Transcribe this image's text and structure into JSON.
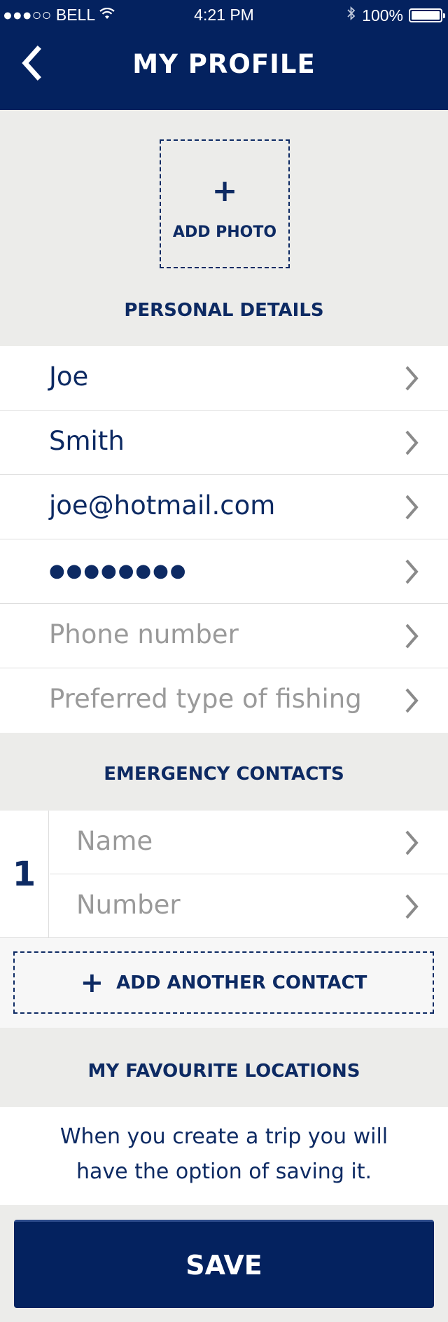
{
  "status_bar": {
    "carrier": "●●●○○ BELL",
    "time": "4:21 PM",
    "battery": "100%"
  },
  "header": {
    "title": "MY PROFILE"
  },
  "photo": {
    "plus": "+",
    "label": "ADD PHOTO"
  },
  "personal_details": {
    "title": "PERSONAL DETAILS",
    "fields": [
      {
        "value": "Joe"
      },
      {
        "value": "Smith"
      },
      {
        "value": "joe@hotmail.com"
      },
      {
        "value": "●●●●●●●●"
      },
      {
        "placeholder": "Phone number"
      },
      {
        "placeholder": "Preferred type of fishing"
      }
    ]
  },
  "emergency_contacts": {
    "title": "EMERGENCY CONTACTS",
    "index": "1",
    "name_placeholder": "Name",
    "number_placeholder": "Number",
    "add_plus": "+",
    "add_label": "ADD ANOTHER CONTACT"
  },
  "favourite_locations": {
    "title": "MY FAVOURITE LOCATIONS",
    "info": "When you create a trip you will have the option of saving it."
  },
  "save_label": "SAVE",
  "colors": {
    "navy": "#04225f",
    "text": "#0d2a63",
    "background": "#ececea",
    "placeholder": "#9a9a9a",
    "chevron": "#8a8a8a"
  }
}
